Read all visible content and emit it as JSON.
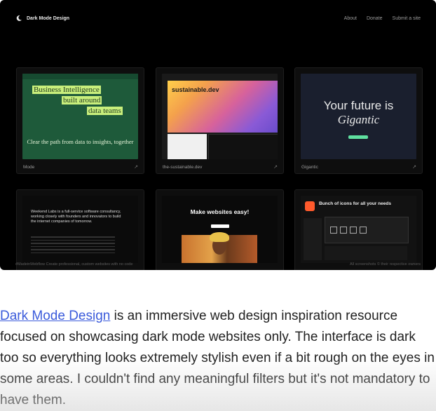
{
  "site": {
    "logo_text": "Dark Mode Design",
    "nav": [
      "About",
      "Donate",
      "Submit a site"
    ]
  },
  "cards": [
    {
      "title": "Mode"
    },
    {
      "title": "the-sustainable.dev"
    },
    {
      "title": "Gigantic"
    },
    {
      "title": ""
    },
    {
      "title": ""
    },
    {
      "title": ""
    }
  ],
  "thumbs": {
    "mode": {
      "line1": "Business Intelligence",
      "line2": "built around",
      "line3": "data teams",
      "sub": "Clear the path from data to insights, together"
    },
    "sustainable": {
      "title": "sustainable.dev"
    },
    "gigantic": {
      "line1": "Your future is",
      "line2": "Gigantic"
    },
    "weekend": {
      "text": "Weekend Labs is a full-service software consultancy, working closely with founders and innovators to build the internet companies of tomorrow."
    },
    "make": {
      "title": "Make websites easy!"
    },
    "icons": {
      "title": "Bunch of icons for all your needs"
    }
  },
  "footer": {
    "left": "#MadeinWebflow  Create professional, custom websites with no code",
    "right": "All screenshots © their respective owners"
  },
  "article": {
    "link": "Dark Mode Design",
    "text": " is an immersive web design inspiration resource focused on showcasing dark mode websites only. The interface is dark too so everything looks extremely stylish even if a bit rough on the eyes in some areas. I couldn't find any meaningful filters but it's not mandatory to have them."
  }
}
